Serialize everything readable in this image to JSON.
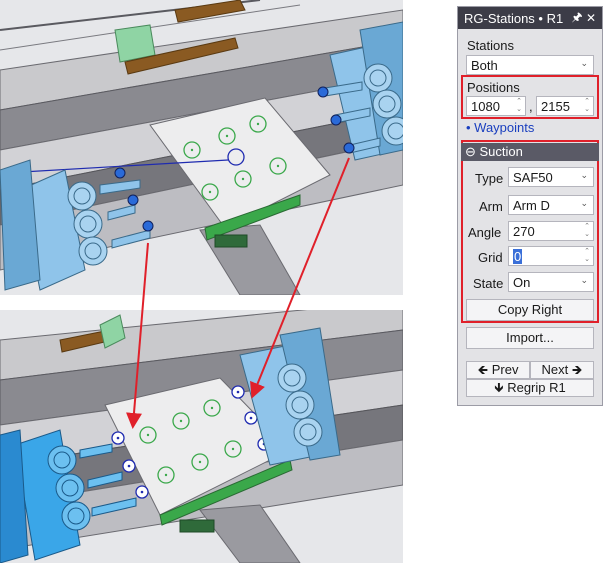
{
  "panel": {
    "title": "RG-Stations • R1",
    "pin_icon": "pin-icon",
    "close_icon": "close-icon",
    "pin_glyph": "🖈",
    "close_glyph": "✕",
    "stations_label": "Stations",
    "stations_value": "Both",
    "positions_label": "Positions",
    "position_x": "1080",
    "position_separator": ",",
    "position_y": "2155",
    "waypoints_link": "• Waypoints",
    "suction_section": "Suction",
    "type_label": "Type",
    "type_value": "SAF50",
    "arm_label": "Arm",
    "arm_value": "Arm D",
    "angle_label": "Angle",
    "angle_value": "270",
    "grid_label": "Grid",
    "grid_value": "0",
    "state_label": "State",
    "state_value": "On",
    "copy_right_button": "Copy Right",
    "import_button": "Import...",
    "prev_button": "Prev",
    "next_button": "Next",
    "regrip_button": "Regrip R1",
    "highlight_color": "#e0202a"
  },
  "colors": {
    "gripper_blue": "#8fc4ea",
    "suction_cup_green": "#3aa84a",
    "waypoint_blue": "#1f2bb0",
    "arrow_red": "#e0202a"
  }
}
